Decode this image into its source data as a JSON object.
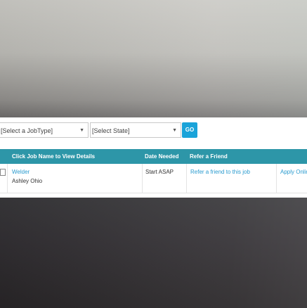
{
  "filters": {
    "job_type_label": "[Select a JobType]",
    "state_label": "[Select State]",
    "go_label": "GO"
  },
  "table": {
    "headers": {
      "job_name": "Click Job Name to View Details",
      "date_needed": "Date Needed",
      "refer": "Refer a Friend"
    },
    "rows": [
      {
        "job_name": "Welder",
        "location": "Ashley Ohio",
        "date_needed": "Start ASAP",
        "refer": "Refer a friend to this job",
        "apply": "Apply Online"
      }
    ]
  },
  "colors": {
    "header_bg": "#2d96a8",
    "go_button": "#1aa3d9",
    "link": "#2a9bcf"
  },
  "icons": {
    "dropdown": "chevron-down-icon"
  }
}
